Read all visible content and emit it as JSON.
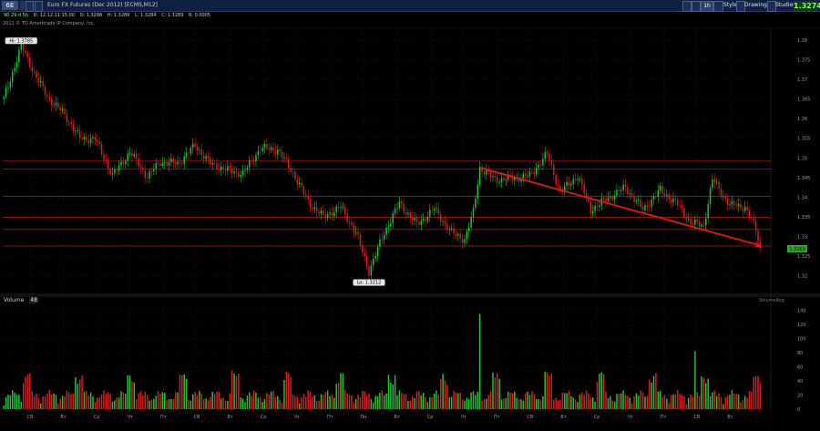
{
  "header": {
    "symbol": "6E",
    "description": "Euro FX Futures (Dec 2012) [ECMS,M12]",
    "time_frame": "1h",
    "style_label": "Style",
    "drawings_label": "Drawings",
    "studies_label": "Studies",
    "last_price": "1.3274"
  },
  "quote": {
    "period": "90 29 d 5h",
    "date": "D: 12.12.11 15:00",
    "open": "O: 1.3288",
    "high": "H: 1.3289",
    "low": "L: 1.3284",
    "close": "C: 1.3289",
    "range": "R: 0.0005"
  },
  "copyright": "2011 © TD Ameritrade IP Company, Inc.",
  "volume_label": "Volume",
  "volume_period": "48",
  "volume_corner_label": "VolumeAvg",
  "colors": {
    "up": "#22c23a",
    "down": "#d42020",
    "hline": "#a01515",
    "trendline": "#dd1a1a",
    "grid": "#3b0d0d",
    "axis_text": "#9a9a9a",
    "last_price_bg": "#2fa52f"
  },
  "chart_data": [
    {
      "type": "candlestick",
      "title": "",
      "y_ticks": [
        "1.38",
        "1.375",
        "1.37",
        "1.365",
        "1.36",
        "1.355",
        "1.35",
        "1.345",
        "1.34",
        "1.335",
        "1.33",
        "1.325",
        "1.32"
      ],
      "ylim": [
        1.316,
        1.3825
      ],
      "x_ticks": [
        "CB",
        "Вт",
        "Ср",
        "Чт",
        "Пт",
        "CB",
        "Вт",
        "Ср",
        "Чт",
        "Пт",
        "Пн",
        "Вт",
        "Ср",
        "Чт",
        "Пт",
        "CB",
        "Вт",
        "Ср",
        "Чт",
        "Пт",
        "CB",
        "Вт"
      ],
      "high_label": "Hi: 1.3785",
      "low_label": "Lo: 1.3212",
      "current_label": "1.3269",
      "current_value": 1.3269,
      "horizontal_lines": [
        1.3493,
        1.3472,
        1.3402,
        1.3349,
        1.3318,
        1.3276
      ],
      "trendline": [
        {
          "bar": 219,
          "y": 1.3475
        },
        {
          "bar": 348,
          "y": 1.3277
        }
      ],
      "key_points": [
        [
          0,
          1.365
        ],
        [
          8,
          1.3785
        ],
        [
          15,
          1.3705
        ],
        [
          20,
          1.3655
        ],
        [
          28,
          1.361
        ],
        [
          35,
          1.355
        ],
        [
          42,
          1.3548
        ],
        [
          50,
          1.3455
        ],
        [
          58,
          1.3515
        ],
        [
          66,
          1.3452
        ],
        [
          72,
          1.349
        ],
        [
          80,
          1.3485
        ],
        [
          88,
          1.3532
        ],
        [
          95,
          1.3485
        ],
        [
          102,
          1.347
        ],
        [
          110,
          1.346
        ],
        [
          118,
          1.3525
        ],
        [
          126,
          1.352
        ],
        [
          133,
          1.3462
        ],
        [
          140,
          1.3388
        ],
        [
          147,
          1.335
        ],
        [
          155,
          1.3375
        ],
        [
          162,
          1.331
        ],
        [
          168,
          1.3212
        ],
        [
          175,
          1.331
        ],
        [
          182,
          1.3385
        ],
        [
          190,
          1.333
        ],
        [
          198,
          1.337
        ],
        [
          206,
          1.331
        ],
        [
          212,
          1.3292
        ],
        [
          216,
          1.3362
        ],
        [
          219,
          1.3475
        ],
        [
          226,
          1.3445
        ],
        [
          234,
          1.3448
        ],
        [
          242,
          1.3455
        ],
        [
          250,
          1.351
        ],
        [
          256,
          1.3412
        ],
        [
          264,
          1.3455
        ],
        [
          270,
          1.3368
        ],
        [
          278,
          1.3398
        ],
        [
          286,
          1.3425
        ],
        [
          294,
          1.3368
        ],
        [
          302,
          1.3418
        ],
        [
          310,
          1.3382
        ],
        [
          316,
          1.3335
        ],
        [
          322,
          1.3328
        ],
        [
          326,
          1.3445
        ],
        [
          334,
          1.338
        ],
        [
          341,
          1.3375
        ],
        [
          346,
          1.3318
        ],
        [
          348,
          1.3269
        ]
      ]
    },
    {
      "type": "bar",
      "title": "",
      "y_ticks": [
        "140",
        "120",
        "100",
        "80",
        "60",
        "40",
        "20",
        "0"
      ],
      "ylim": [
        0,
        146
      ],
      "spikes": [
        [
          219,
          135
        ],
        [
          318,
          82
        ]
      ]
    }
  ]
}
